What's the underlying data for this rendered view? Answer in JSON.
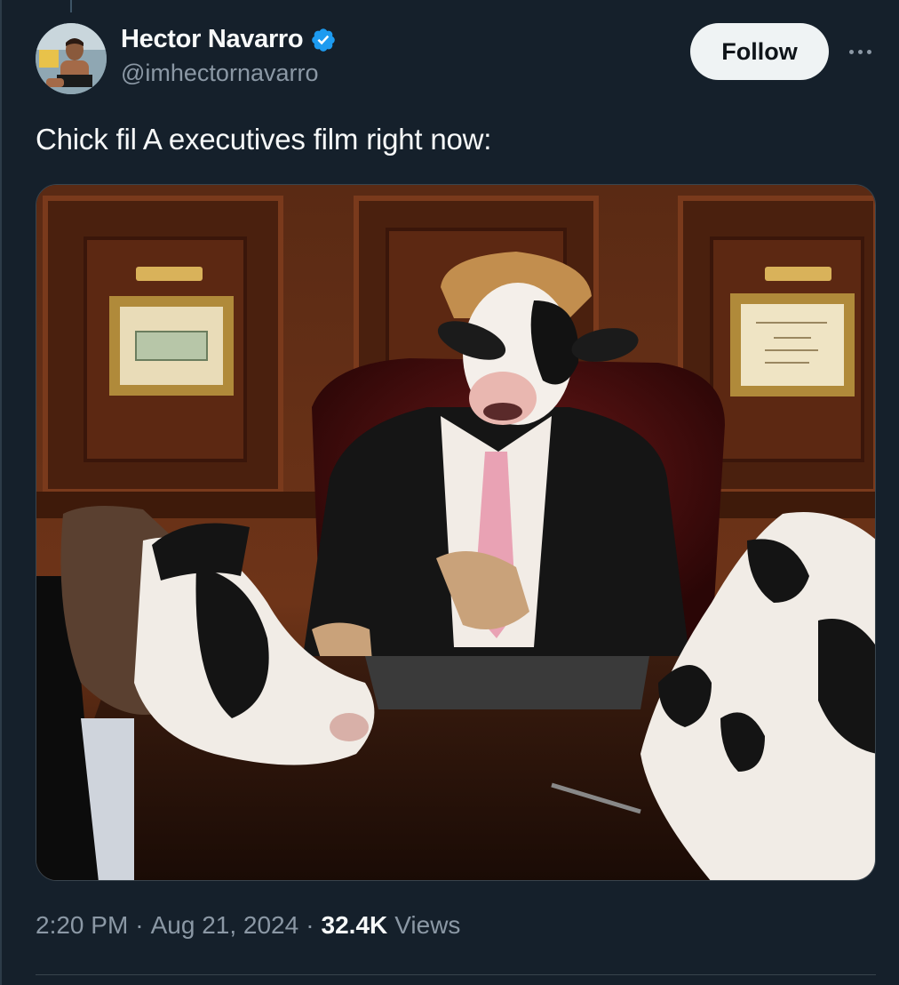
{
  "tweet": {
    "author": {
      "name": "Hector Navarro",
      "handle": "@imhectornavarro",
      "verified": true,
      "avatar_icon": "profile-photo"
    },
    "follow_label": "Follow",
    "more_icon": "more-options-icon",
    "text": "Chick fil A executives film right now:",
    "media": {
      "type": "photo",
      "icon": "cow-executives-boardroom-image"
    },
    "meta": {
      "time": "2:20 PM",
      "separator": "·",
      "date": "Aug 21, 2024",
      "views_count": "32.4K",
      "views_label": "Views"
    }
  },
  "colors": {
    "background": "#15202b",
    "text_primary": "#f7f9f9",
    "text_secondary": "#8b98a5",
    "verified_blue": "#1d9bf0",
    "follow_bg": "#eff3f4"
  }
}
